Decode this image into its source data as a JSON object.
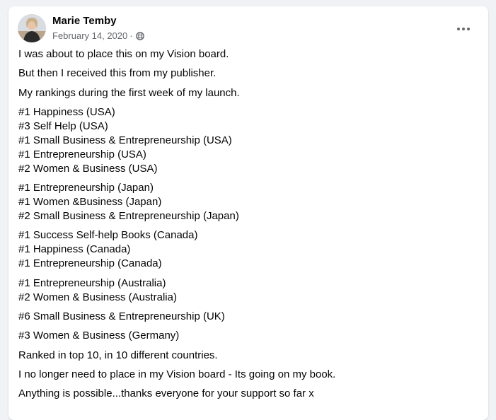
{
  "post": {
    "author": "Marie Temby",
    "date": "February 14, 2020",
    "separator": "·",
    "audience_icon": "globe-icon",
    "menu_icon": "more-options-icon"
  },
  "content": {
    "paragraphs": [
      [
        "I was about to place this on my Vision board."
      ],
      [
        "But then I received this from my publisher."
      ],
      [
        "My rankings during the first week of my launch."
      ],
      [
        "#1 Happiness (USA)",
        "#3 Self Help (USA)",
        "#1 Small Business & Entrepreneurship (USA)",
        "#1 Entrepreneurship (USA)",
        "#2 Women & Business (USA)"
      ],
      [
        "#1 Entrepreneurship (Japan)",
        "#1 Women &Business (Japan)",
        "#2 Small Business & Entrepreneurship (Japan)"
      ],
      [
        "#1 Success Self-help Books (Canada)",
        "#1 Happiness (Canada)",
        "#1 Entrepreneurship (Canada)"
      ],
      [
        "#1 Entrepreneurship (Australia)",
        "#2 Women & Business (Australia)"
      ],
      [
        "#6 Small Business & Entrepreneurship (UK)"
      ],
      [
        "#3 Women & Business (Germany)"
      ],
      [
        "Ranked in top 10, in 10 different countries."
      ],
      [
        "I no longer need to place in my Vision board - Its going on my book."
      ],
      [
        "Anything is possible...thanks everyone for your support so far x"
      ]
    ]
  }
}
